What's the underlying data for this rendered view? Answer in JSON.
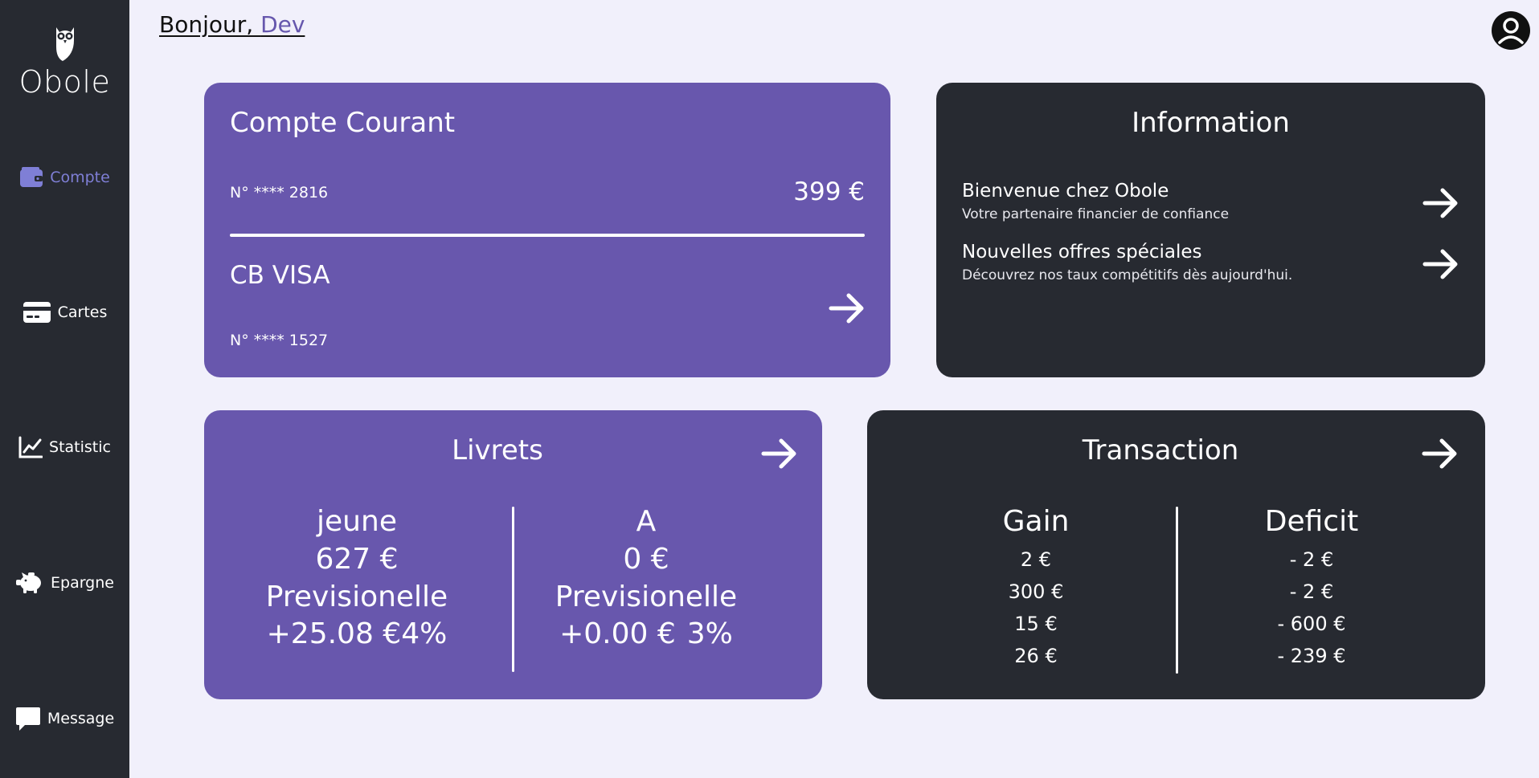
{
  "brand": {
    "name": "Obole"
  },
  "greeting": {
    "prefix": "Bonjour, ",
    "name": "Dev"
  },
  "nav": [
    {
      "label": "Compte",
      "icon": "wallet-icon",
      "active": true
    },
    {
      "label": "Cartes",
      "icon": "credit-card-icon",
      "active": false
    },
    {
      "label": "Statistic",
      "icon": "chart-line-icon",
      "active": false
    },
    {
      "label": "Epargne",
      "icon": "piggy-bank-icon",
      "active": false
    },
    {
      "label": "Message",
      "icon": "message-icon",
      "active": false
    }
  ],
  "compte": {
    "title": "Compte Courant",
    "account_number": "N° **** 2816",
    "balance": "399 €",
    "card_title": "CB VISA",
    "card_number": "N° **** 1527"
  },
  "info": {
    "title": "Information",
    "items": [
      {
        "title": "Bienvenue chez Obole",
        "subtitle": "Votre partenaire financier de confiance"
      },
      {
        "title": "Nouvelles offres spéciales",
        "subtitle": "Découvrez nos taux compétitifs dès aujourd'hui."
      }
    ]
  },
  "livrets": {
    "title": "Livrets",
    "items": [
      {
        "name": "jeune",
        "amount": "627 €",
        "label": "Previsionelle",
        "forecast": "+25.08 €",
        "rate": "4%"
      },
      {
        "name": "A",
        "amount": "0 €",
        "label": "Previsionelle",
        "forecast": "+0.00 €",
        "rate": "3%"
      }
    ]
  },
  "transaction": {
    "title": "Transaction",
    "gain_label": "Gain",
    "deficit_label": "Deficit",
    "gains": [
      "2 €",
      "300 €",
      "15 €",
      "26 €"
    ],
    "deficits": [
      "- 2 €",
      "- 2 €",
      "- 600 €",
      "- 239 €"
    ]
  },
  "colors": {
    "sidebar": "#272a31",
    "background": "#f1f0fb",
    "purple_card": "#6857ad",
    "dark_card": "#272a31",
    "accent": "#7f7fd6"
  }
}
